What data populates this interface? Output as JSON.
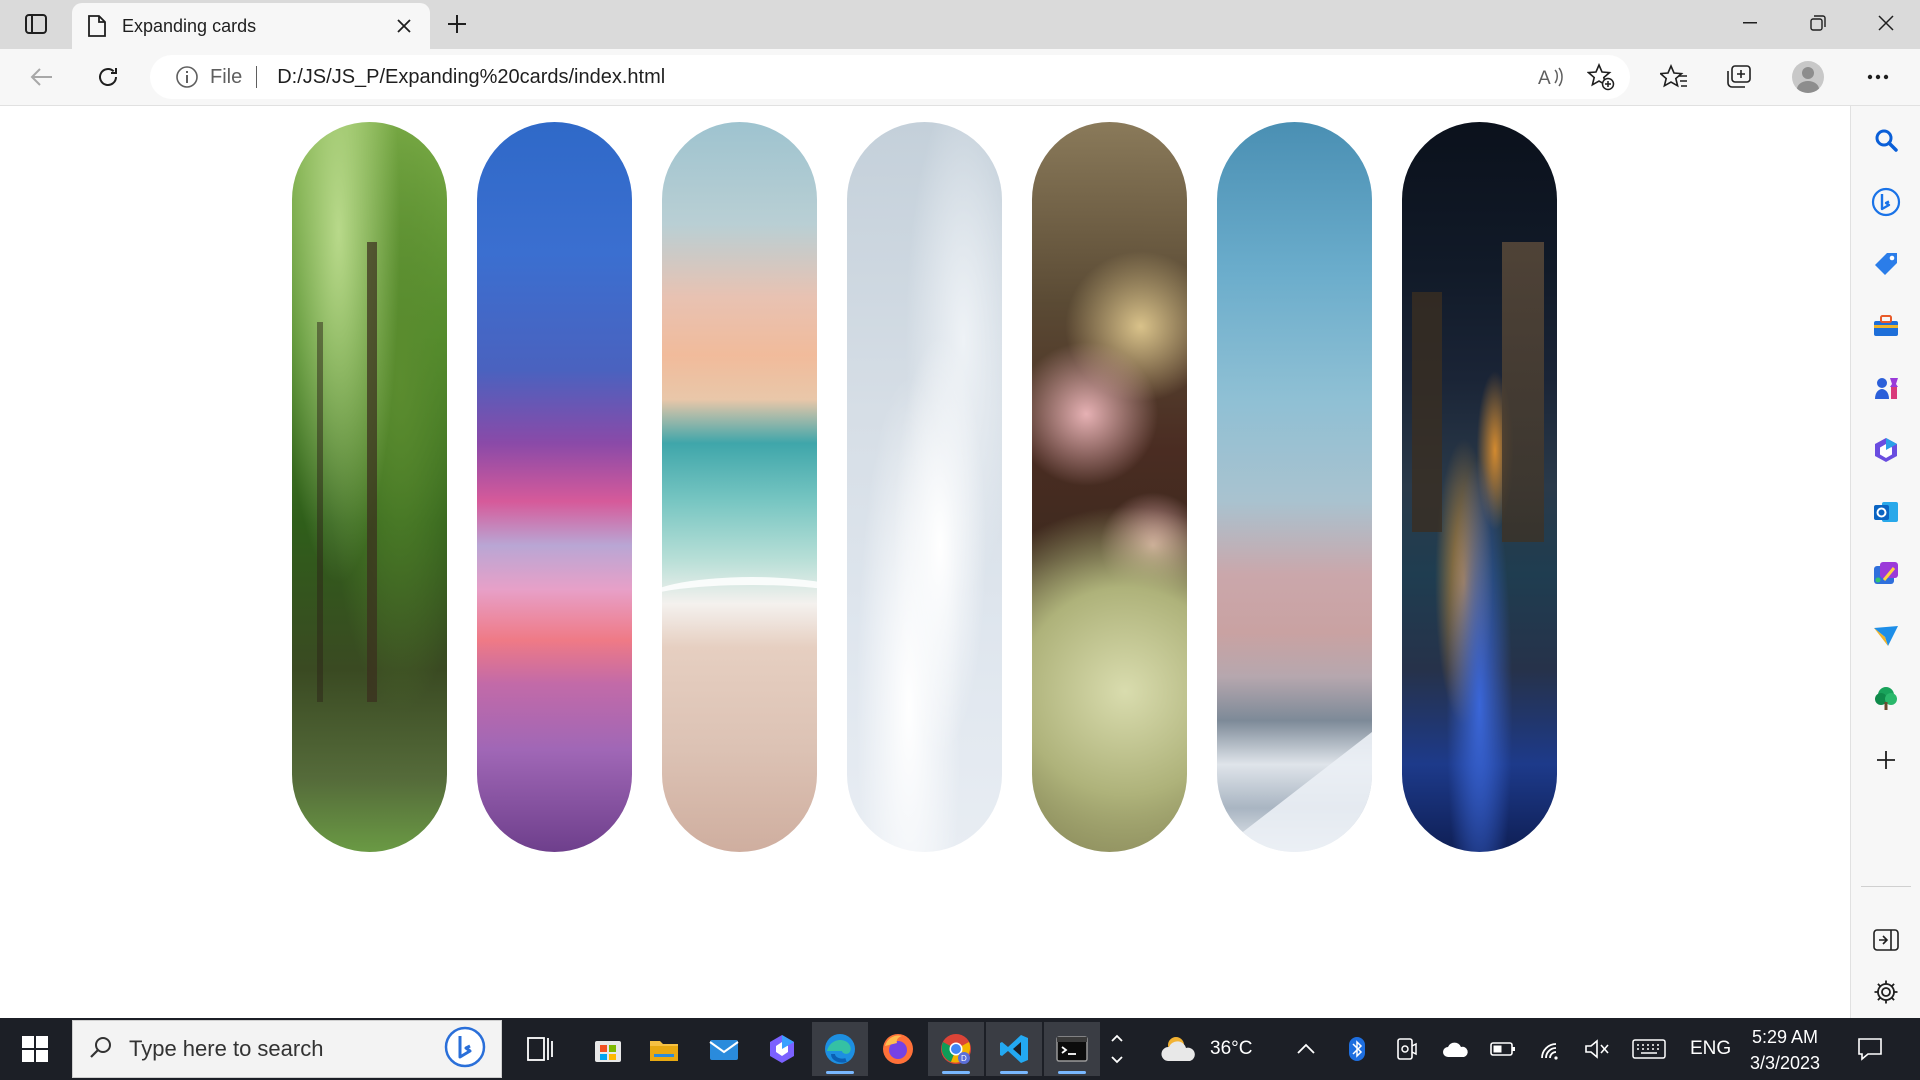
{
  "browser": {
    "tab": {
      "title": "Expanding cards"
    },
    "address": {
      "scheme_label": "File",
      "url": "D:/JS/JS_P/Expanding%20cards/index.html"
    }
  },
  "page": {
    "cards": [
      {
        "name": "forest"
      },
      {
        "name": "sunset"
      },
      {
        "name": "beach"
      },
      {
        "name": "clouds"
      },
      {
        "name": "flowers"
      },
      {
        "name": "mountain"
      },
      {
        "name": "city"
      }
    ]
  },
  "taskbar": {
    "search_placeholder": "Type here to search",
    "weather": "36°C",
    "language": "ENG",
    "time": "5:29 AM",
    "date": "3/3/2023"
  },
  "colors": {
    "edge_accent": "#0078d4",
    "taskbar_bg": "#1c1f26",
    "titlebar_bg": "#dadada"
  }
}
